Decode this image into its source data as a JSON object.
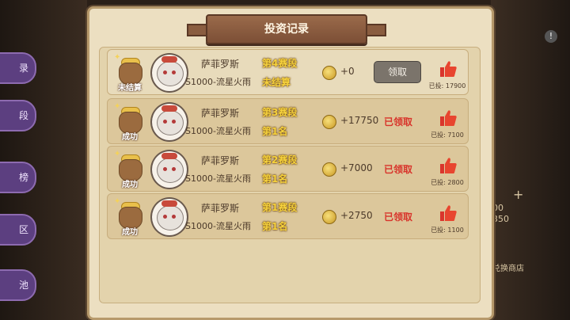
{
  "window": {
    "title": "投资记录"
  },
  "side_tabs": [
    "录",
    "段",
    "榜",
    "区",
    "池"
  ],
  "right_panel": {
    "value_a": "00",
    "value_b": "350",
    "shop_label": "兑换商店"
  },
  "records": [
    {
      "status": "未结算",
      "hero": "萨菲罗斯",
      "server": "S1000-流星火雨",
      "stage": "第4赛段",
      "result": "未结算",
      "amount": "+0",
      "action": "领取",
      "claimed": false,
      "voted": "已投: 17900"
    },
    {
      "status": "成功",
      "hero": "萨菲罗斯",
      "server": "S1000-流星火雨",
      "stage": "第3赛段",
      "result": "第1名",
      "amount": "+17750",
      "action": "已领取",
      "claimed": true,
      "voted": "已投: 7100"
    },
    {
      "status": "成功",
      "hero": "萨菲罗斯",
      "server": "S1000-流星火雨",
      "stage": "第2赛段",
      "result": "第1名",
      "amount": "+7000",
      "action": "已领取",
      "claimed": true,
      "voted": "已投: 2800"
    },
    {
      "status": "成功",
      "hero": "萨菲罗斯",
      "server": "S1000-流星火雨",
      "stage": "第1赛段",
      "result": "第1名",
      "amount": "+2750",
      "action": "已领取",
      "claimed": true,
      "voted": "已投: 1100"
    }
  ]
}
